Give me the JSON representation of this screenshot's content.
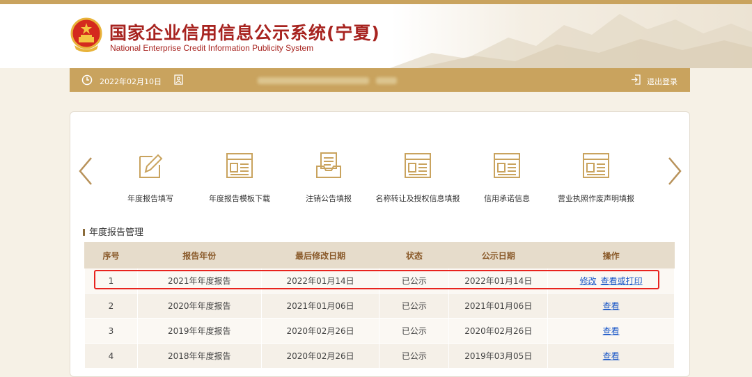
{
  "header": {
    "title_cn": "国家企业信用信息公示系统(宁夏)",
    "title_en": "National Enterprise Credit Information Publicity System"
  },
  "infobar": {
    "date": "2022年02月10日",
    "logout_label": "退出登录"
  },
  "functions": [
    {
      "label": "年度报告填写",
      "icon": "edit-form-icon"
    },
    {
      "label": "年度报告模板下载",
      "icon": "document-template-icon"
    },
    {
      "label": "注销公告填报",
      "icon": "inbox-tray-icon"
    },
    {
      "label": "名称转让及授权信息填报",
      "icon": "document-template-icon"
    },
    {
      "label": "信用承诺信息",
      "icon": "document-template-icon"
    },
    {
      "label": "营业执照作废声明填报",
      "icon": "document-template-icon"
    }
  ],
  "section": {
    "title": "年度报告管理"
  },
  "table": {
    "columns": [
      "序号",
      "报告年份",
      "最后修改日期",
      "状态",
      "公示日期",
      "操作"
    ],
    "rows": [
      {
        "no": "1",
        "year": "2021年年度报告",
        "modified": "2022年01月14日",
        "status": "已公示",
        "published": "2022年01月14日",
        "actions": [
          "修改",
          "查看或打印"
        ]
      },
      {
        "no": "2",
        "year": "2020年年度报告",
        "modified": "2021年01月06日",
        "status": "已公示",
        "published": "2021年01月06日",
        "actions": [
          "查看"
        ]
      },
      {
        "no": "3",
        "year": "2019年年度报告",
        "modified": "2020年02月26日",
        "status": "已公示",
        "published": "2020年02月26日",
        "actions": [
          "查看"
        ]
      },
      {
        "no": "4",
        "year": "2018年年度报告",
        "modified": "2020年02月26日",
        "status": "已公示",
        "published": "2019年03月05日",
        "actions": [
          "查看"
        ]
      }
    ]
  },
  "colors": {
    "brand_red": "#a7231f",
    "gold": "#c9a35e",
    "link_blue": "#1a57c7",
    "highlight_red": "#e8231e"
  }
}
